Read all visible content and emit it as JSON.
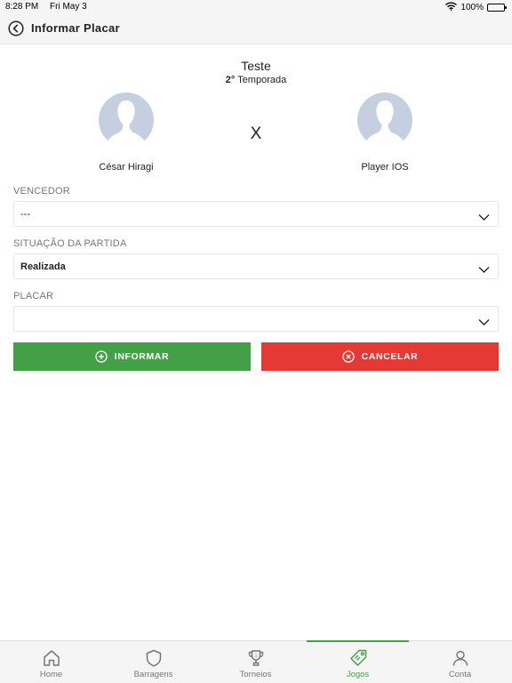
{
  "status_bar": {
    "time": "8:28 PM",
    "date": "Fri May 3",
    "battery": "100%"
  },
  "header": {
    "title": "Informar Placar"
  },
  "match": {
    "league": "Teste",
    "season_number": "2°",
    "season_label": "Temporada",
    "versus": "X",
    "player_left": "César Hiragi",
    "player_right": "Player IOS"
  },
  "form": {
    "winner": {
      "label": "VENCEDOR",
      "value": "---"
    },
    "situation": {
      "label": "SITUAÇÃO DA PARTIDA",
      "value": "Realizada"
    },
    "score": {
      "label": "PLACAR",
      "value": ""
    }
  },
  "actions": {
    "submit_label": "INFORMAR",
    "cancel_label": "CANCELAR"
  },
  "colors": {
    "accent": "#43a047",
    "danger": "#e53935",
    "avatar": "#c5cfe0"
  },
  "tabs": [
    {
      "label": "Home",
      "icon": "home-icon",
      "active": false
    },
    {
      "label": "Barragens",
      "icon": "shield-icon",
      "active": false
    },
    {
      "label": "Torneios",
      "icon": "trophy-icon",
      "active": false
    },
    {
      "label": "Jogos",
      "icon": "tag-icon",
      "active": true
    },
    {
      "label": "Conta",
      "icon": "user-icon",
      "active": false
    }
  ]
}
